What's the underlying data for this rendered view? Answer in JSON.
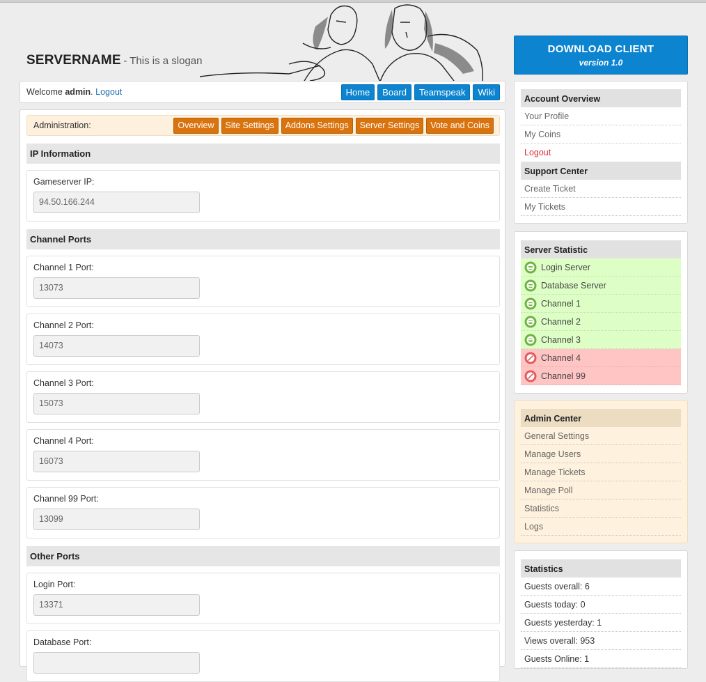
{
  "header": {
    "site_name": "SERVERNAME",
    "slogan": "- This is a slogan"
  },
  "welcome": {
    "prefix": "Welcome",
    "user": "admin",
    "sep": ".",
    "logout": "Logout"
  },
  "nav": [
    "Home",
    "Board",
    "Teamspeak",
    "Wiki"
  ],
  "admin": {
    "label": "Administration:",
    "buttons": [
      "Overview",
      "Site Settings",
      "Addons Settings",
      "Server Settings",
      "Vote and Coins"
    ]
  },
  "sections": {
    "ip": "IP Information",
    "channels": "Channel Ports",
    "other": "Other Ports"
  },
  "fields": {
    "gameserver": {
      "label": "Gameserver IP:",
      "value": "94.50.166.244"
    },
    "ch1": {
      "label": "Channel 1 Port:",
      "value": "13073"
    },
    "ch2": {
      "label": "Channel 2 Port:",
      "value": "14073"
    },
    "ch3": {
      "label": "Channel 3 Port:",
      "value": "15073"
    },
    "ch4": {
      "label": "Channel 4 Port:",
      "value": "16073"
    },
    "ch99": {
      "label": "Channel 99 Port:",
      "value": "13099"
    },
    "login": {
      "label": "Login Port:",
      "value": "13371"
    },
    "database": {
      "label": "Database Port:",
      "value": ""
    }
  },
  "download": {
    "title": "DOWNLOAD CLIENT",
    "version": "version 1.0"
  },
  "account": {
    "header": "Account Overview",
    "items": [
      "Your Profile",
      "My Coins",
      "Logout"
    ],
    "support_header": "Support Center",
    "support_items": [
      "Create Ticket",
      "My Tickets"
    ]
  },
  "server_statistic": {
    "header": "Server Statistic",
    "servers": [
      {
        "name": "Login Server",
        "status": "online"
      },
      {
        "name": "Database Server",
        "status": "online"
      },
      {
        "name": "Channel 1",
        "status": "online"
      },
      {
        "name": "Channel 2",
        "status": "online"
      },
      {
        "name": "Channel 3",
        "status": "online"
      },
      {
        "name": "Channel 4",
        "status": "offline"
      },
      {
        "name": "Channel 99",
        "status": "offline"
      }
    ]
  },
  "admin_center": {
    "header": "Admin Center",
    "items": [
      "General Settings",
      "Manage Users",
      "Manage Tickets",
      "Manage Poll",
      "Statistics",
      "Logs"
    ]
  },
  "statistics": {
    "header": "Statistics",
    "items": [
      "Guests overall: 6",
      "Guests today: 0",
      "Guests yesterday: 1",
      "Views overall: 953",
      "Guests Online: 1"
    ]
  },
  "colors": {
    "accent_blue": "#0d84cf",
    "accent_orange": "#d9730d",
    "online": "#ddffc6",
    "offline": "#ffc4c4"
  }
}
